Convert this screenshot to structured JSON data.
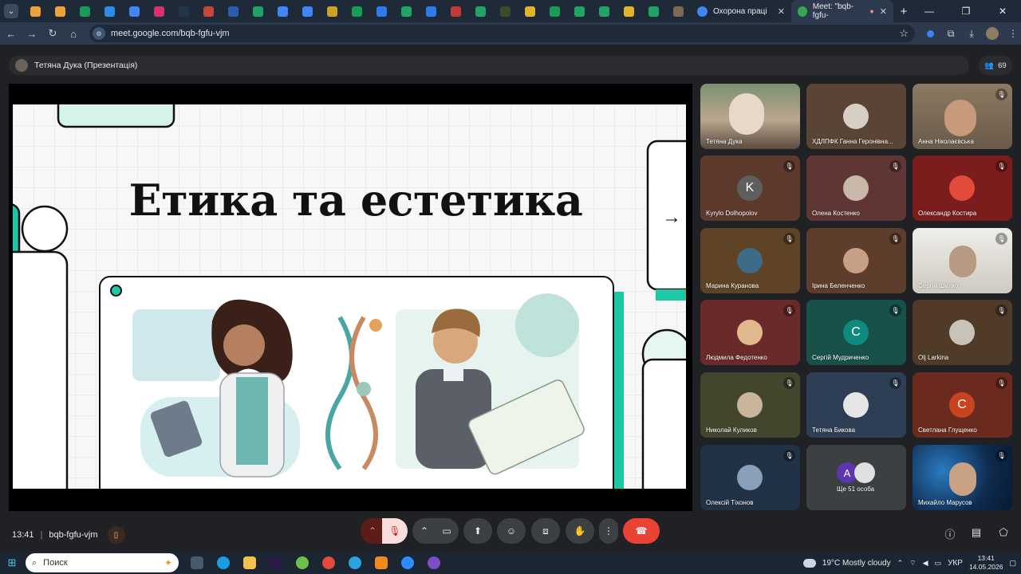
{
  "browser": {
    "tabs": [
      {
        "title": "Охорона праці",
        "active": false
      },
      {
        "title": "Meet: \"bqb-fgfu-",
        "active": true
      }
    ],
    "new_tab": "+",
    "url": "meet.google.com/bqb-fgfu-vjm"
  },
  "meet": {
    "presenter_label": "Тетяна Дука (Презентація)",
    "participant_count": "69",
    "slide": {
      "title": "Етика та естетика",
      "next_arrow": "→"
    },
    "tiles": [
      {
        "name": "Тетяна Дука",
        "bg": "#6b5a4a",
        "initial": "",
        "avatar_color": ""
      },
      {
        "name": "ХДЛПФК Ганна Геронівна...",
        "bg": "#5a4436",
        "initial": "",
        "avatar_color": "#d8cfc4"
      },
      {
        "name": "Анна Ніколаєвська",
        "bg": "#6a5c4c",
        "initial": "",
        "avatar_color": ""
      },
      {
        "name": "Kyrylo Dolhopolov",
        "bg": "#5e3a2c",
        "initial": "K",
        "avatar_color": "#5f5f5f"
      },
      {
        "name": "Олена Костенко",
        "bg": "#5f3634",
        "initial": "",
        "avatar_color": "#c9b7a9"
      },
      {
        "name": "Олександр Костира",
        "bg": "#7b1d1d",
        "initial": "",
        "avatar_color": "#e24a3b"
      },
      {
        "name": "Марина Куранова",
        "bg": "#5e4326",
        "initial": "",
        "avatar_color": "#3c6c88"
      },
      {
        "name": "Ірина Беленченко",
        "bg": "#5e3d2c",
        "initial": "",
        "avatar_color": "#c79f86"
      },
      {
        "name": "Сергій Шилко",
        "bg": "#d8d4cc",
        "initial": "",
        "avatar_color": ""
      },
      {
        "name": "Людмила Федотенко",
        "bg": "#6a2a2a",
        "initial": "",
        "avatar_color": "#e1b98d"
      },
      {
        "name": "Сергій Мудриченко",
        "bg": "#18504a",
        "initial": "С",
        "avatar_color": "#0f8a7e"
      },
      {
        "name": "Olj Larkina",
        "bg": "#4f3b28",
        "initial": "",
        "avatar_color": "#c9c2b8"
      },
      {
        "name": "Николай Куликов",
        "bg": "#43452c",
        "initial": "",
        "avatar_color": "#c9b59c"
      },
      {
        "name": "Тетяна Бикова",
        "bg": "#2e3f55",
        "initial": "",
        "avatar_color": "#e6e6e6"
      },
      {
        "name": "Светлана Глущенко",
        "bg": "#6a2b1e",
        "initial": "С",
        "avatar_color": "#c8431f"
      },
      {
        "name": "Олексій Тіхонов",
        "bg": "#223246",
        "initial": "",
        "avatar_color": "#8aa0b8"
      },
      {
        "name": "Ще 51 особа",
        "bg": "#3c4043",
        "initial": "A",
        "avatar_color": "#5e35b1"
      },
      {
        "name": "Михайло Марусов",
        "bg": "#0e2a4d",
        "initial": "",
        "avatar_color": ""
      }
    ],
    "time": "13:41",
    "separator": "|",
    "meeting_code": "bqb-fgfu-vjm"
  },
  "taskbar": {
    "search_placeholder": "Поиск",
    "weather": "19°C  Mostly cloudy",
    "language": "УКР",
    "time": "13:41",
    "date": "14.05.2026"
  },
  "colors": {
    "accent": "#1ec8a6",
    "hangup": "#ea4335",
    "mic_muted": "#f9dedc"
  }
}
